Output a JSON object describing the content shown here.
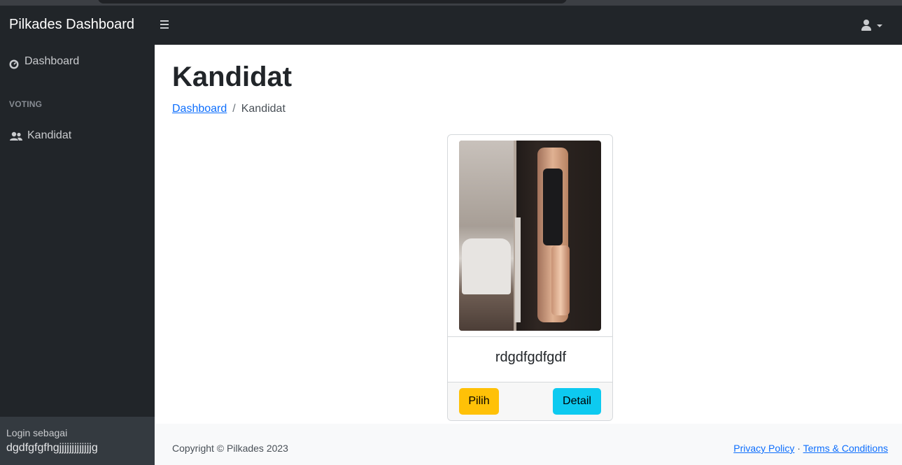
{
  "navbar": {
    "brand": "Pilkades Dashboard"
  },
  "sidebar": {
    "items": [
      {
        "label": "Dashboard",
        "icon": "tachometer-icon"
      },
      {
        "label": "Kandidat",
        "icon": "users-icon"
      }
    ],
    "heading": "VOTING",
    "footer": {
      "label": "Login sebagai",
      "user": "dgdfgfgfhgjjjjjjjjjjjjjg"
    }
  },
  "main": {
    "title": "Kandidat",
    "breadcrumb": {
      "link": "Dashboard",
      "current": "Kandidat"
    },
    "card": {
      "name": "rdgdfgdfgdf",
      "pilih": "Pilih",
      "detail": "Detail"
    }
  },
  "footer": {
    "copyright": "Copyright © Pilkades 2023",
    "privacy": "Privacy Policy",
    "separator": "·",
    "terms": "Terms & Conditions"
  },
  "colors": {
    "nav": "#212529",
    "accent_link": "#0d6efd",
    "warning": "#ffc107",
    "info": "#0dcaf0"
  }
}
